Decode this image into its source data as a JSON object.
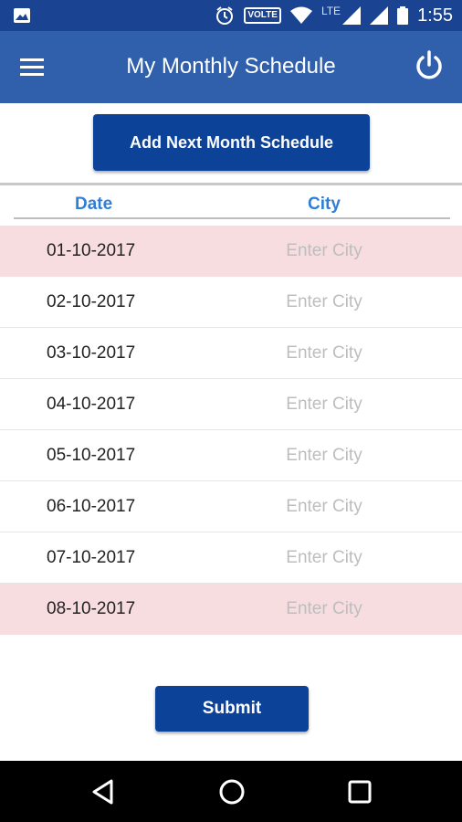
{
  "status_bar": {
    "time": "1:55",
    "volte_label": "VOLTE",
    "network_label": "LTE",
    "icons": [
      "image-icon",
      "alarm-icon",
      "volte-icon",
      "wifi-icon",
      "signal-icon",
      "signal-icon",
      "battery-icon"
    ]
  },
  "app_bar": {
    "title": "My Monthly Schedule",
    "menu_icon": "menu-icon",
    "power_icon": "power-icon",
    "color": "#3060ac"
  },
  "add_button_label": "Add Next Month Schedule",
  "table": {
    "headers": {
      "date": "Date",
      "city": "City"
    },
    "city_placeholder": "Enter City",
    "rows": [
      {
        "date": "01-10-2017",
        "city": "",
        "highlighted": true
      },
      {
        "date": "02-10-2017",
        "city": "",
        "highlighted": false
      },
      {
        "date": "03-10-2017",
        "city": "",
        "highlighted": false
      },
      {
        "date": "04-10-2017",
        "city": "",
        "highlighted": false
      },
      {
        "date": "05-10-2017",
        "city": "",
        "highlighted": false
      },
      {
        "date": "06-10-2017",
        "city": "",
        "highlighted": false
      },
      {
        "date": "07-10-2017",
        "city": "",
        "highlighted": false
      },
      {
        "date": "08-10-2017",
        "city": "",
        "highlighted": true
      }
    ]
  },
  "submit_label": "Submit",
  "colors": {
    "primary_button": "#0d4299",
    "header_text": "#2f7fd6",
    "highlight_row": "#f8dde0"
  },
  "nav_bar": {
    "icons": [
      "back-icon",
      "home-icon",
      "recents-icon"
    ]
  }
}
